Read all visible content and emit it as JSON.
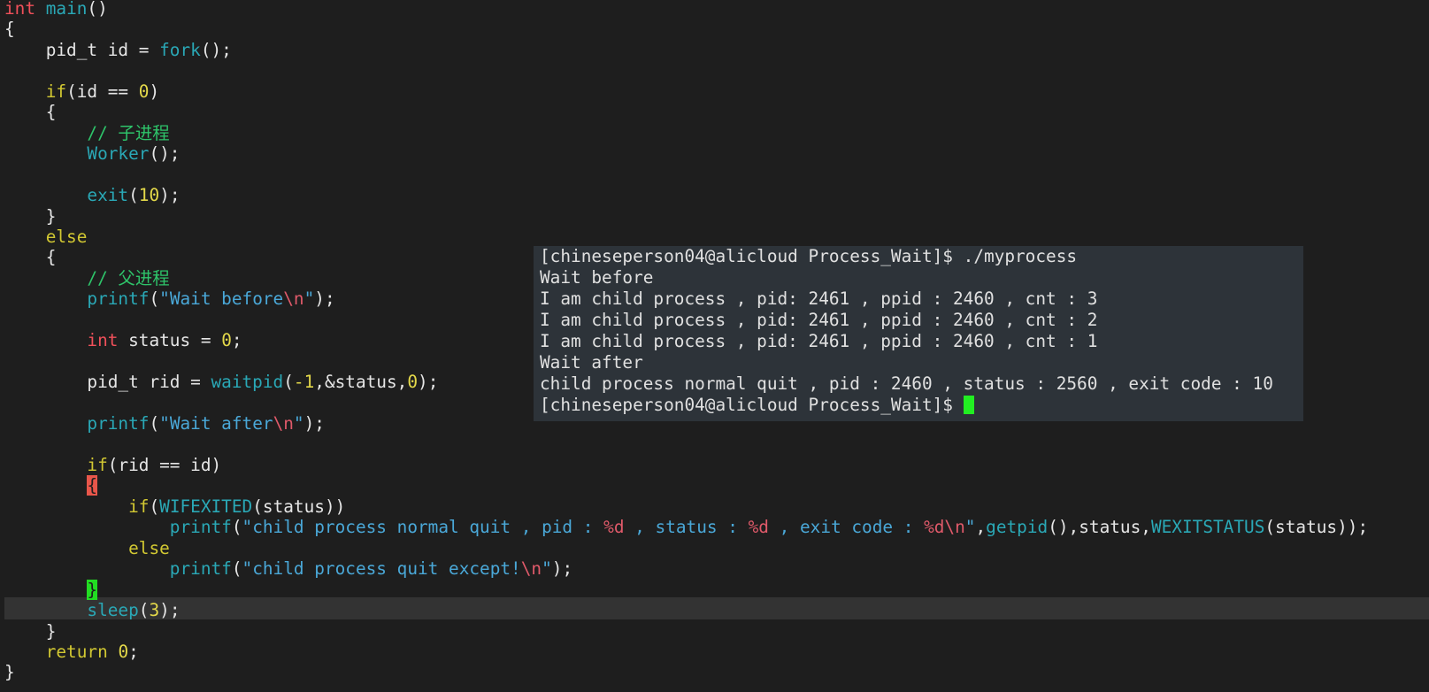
{
  "editor": {
    "lines": [
      [
        {
          "t": "int",
          "c": "kw-type"
        },
        {
          "t": " "
        },
        {
          "t": "main",
          "c": "fn"
        },
        {
          "t": "()"
        }
      ],
      [
        {
          "t": "{"
        }
      ],
      [
        {
          "t": "    pid_t id = "
        },
        {
          "t": "fork",
          "c": "fn"
        },
        {
          "t": "();"
        }
      ],
      [],
      [
        {
          "t": "    "
        },
        {
          "t": "if",
          "c": "kw"
        },
        {
          "t": "(id == "
        },
        {
          "t": "0",
          "c": "num"
        },
        {
          "t": ")"
        }
      ],
      [
        {
          "t": "    {"
        }
      ],
      [
        {
          "t": "        "
        },
        {
          "t": "// 子进程",
          "c": "cm"
        }
      ],
      [
        {
          "t": "        "
        },
        {
          "t": "Worker",
          "c": "fn"
        },
        {
          "t": "();"
        }
      ],
      [],
      [
        {
          "t": "        "
        },
        {
          "t": "exit",
          "c": "fn"
        },
        {
          "t": "("
        },
        {
          "t": "10",
          "c": "num"
        },
        {
          "t": ");"
        }
      ],
      [
        {
          "t": "    }"
        }
      ],
      [
        {
          "t": "    "
        },
        {
          "t": "else",
          "c": "kw"
        }
      ],
      [
        {
          "t": "    {"
        }
      ],
      [
        {
          "t": "        "
        },
        {
          "t": "// 父进程",
          "c": "cm"
        }
      ],
      [
        {
          "t": "        "
        },
        {
          "t": "printf",
          "c": "fn"
        },
        {
          "t": "("
        },
        {
          "t": "\"Wait before",
          "c": "str"
        },
        {
          "t": "\\n",
          "c": "esc"
        },
        {
          "t": "\"",
          "c": "str"
        },
        {
          "t": ");"
        }
      ],
      [],
      [
        {
          "t": "        "
        },
        {
          "t": "int",
          "c": "kw-type"
        },
        {
          "t": " status = "
        },
        {
          "t": "0",
          "c": "num"
        },
        {
          "t": ";"
        }
      ],
      [],
      [
        {
          "t": "        pid_t rid = "
        },
        {
          "t": "waitpid",
          "c": "fn"
        },
        {
          "t": "("
        },
        {
          "t": "-1",
          "c": "num"
        },
        {
          "t": ",&status,"
        },
        {
          "t": "0",
          "c": "num"
        },
        {
          "t": ");"
        }
      ],
      [],
      [
        {
          "t": "        "
        },
        {
          "t": "printf",
          "c": "fn"
        },
        {
          "t": "("
        },
        {
          "t": "\"Wait after",
          "c": "str"
        },
        {
          "t": "\\n",
          "c": "esc"
        },
        {
          "t": "\"",
          "c": "str"
        },
        {
          "t": ");"
        }
      ],
      [],
      [
        {
          "t": "        "
        },
        {
          "t": "if",
          "c": "kw"
        },
        {
          "t": "(rid == id)"
        }
      ],
      [
        {
          "t": "        "
        },
        {
          "t": "{",
          "c": "brace-red"
        }
      ],
      [
        {
          "t": "            "
        },
        {
          "t": "if",
          "c": "kw"
        },
        {
          "t": "("
        },
        {
          "t": "WIFEXITED",
          "c": "fn"
        },
        {
          "t": "(status))"
        }
      ],
      [
        {
          "t": "                "
        },
        {
          "t": "printf",
          "c": "fn"
        },
        {
          "t": "("
        },
        {
          "t": "\"child process normal quit , pid : ",
          "c": "str"
        },
        {
          "t": "%d",
          "c": "esc"
        },
        {
          "t": " , status : ",
          "c": "str"
        },
        {
          "t": "%d",
          "c": "esc"
        },
        {
          "t": " , exit code : ",
          "c": "str"
        },
        {
          "t": "%d\\n",
          "c": "esc"
        },
        {
          "t": "\"",
          "c": "str"
        },
        {
          "t": ","
        },
        {
          "t": "getpid",
          "c": "fn"
        },
        {
          "t": "(),status,"
        },
        {
          "t": "WEXITSTATUS",
          "c": "fn"
        },
        {
          "t": "(status));"
        }
      ],
      [
        {
          "t": "            "
        },
        {
          "t": "else",
          "c": "kw"
        }
      ],
      [
        {
          "t": "                "
        },
        {
          "t": "printf",
          "c": "fn"
        },
        {
          "t": "("
        },
        {
          "t": "\"child process quit except!",
          "c": "str"
        },
        {
          "t": "\\n",
          "c": "esc"
        },
        {
          "t": "\"",
          "c": "str"
        },
        {
          "t": ");"
        }
      ],
      [
        {
          "t": "        "
        },
        {
          "t": "}",
          "c": "brace-green"
        }
      ],
      [
        {
          "t": "        "
        },
        {
          "t": "sleep",
          "c": "fn"
        },
        {
          "t": "("
        },
        {
          "t": "3",
          "c": "num"
        },
        {
          "t": ");"
        }
      ],
      [
        {
          "t": "    }"
        }
      ],
      [
        {
          "t": "    "
        },
        {
          "t": "return",
          "c": "kw"
        },
        {
          "t": " "
        },
        {
          "t": "0",
          "c": "num"
        },
        {
          "t": ";"
        }
      ],
      [
        {
          "t": "}"
        }
      ]
    ]
  },
  "terminal": {
    "lines": [
      "[chineseperson04@alicloud Process_Wait]$ ./myprocess",
      "Wait before",
      "I am child process , pid: 2461 , ppid : 2460 , cnt : 3",
      "I am child process , pid: 2461 , ppid : 2460 , cnt : 2",
      "I am child process , pid: 2461 , ppid : 2460 , cnt : 1",
      "Wait after",
      "child process normal quit , pid : 2460 , status : 2560 , exit code : 10"
    ],
    "prompt": "[chineseperson04@alicloud Process_Wait]$ "
  },
  "colors": {
    "background": "#1e1e1e",
    "terminal_background": "#2d3339",
    "cursor": "#22ee22"
  }
}
